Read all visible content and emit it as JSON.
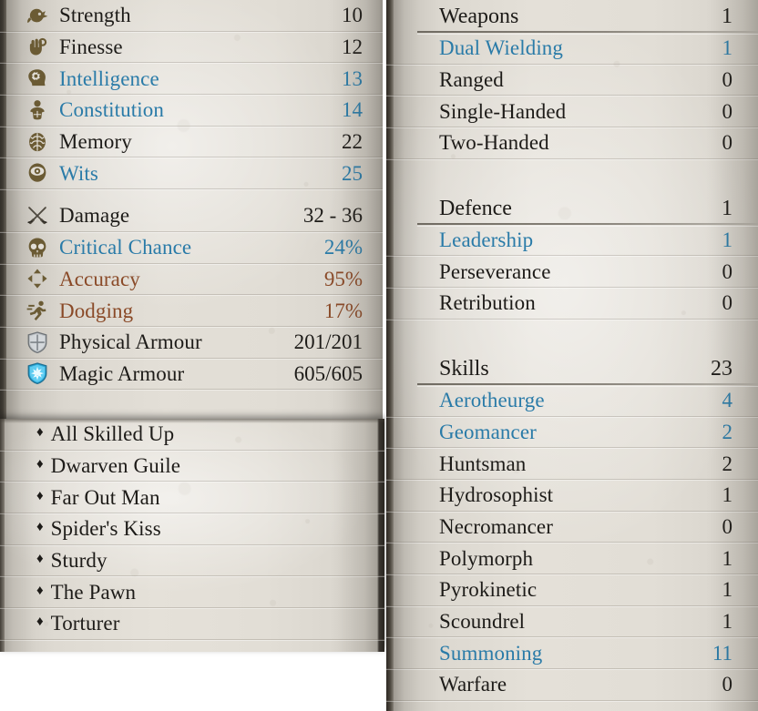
{
  "attributes": [
    {
      "icon": "strength-icon",
      "label": "Strength",
      "value": "10",
      "color": "dark"
    },
    {
      "icon": "finesse-icon",
      "label": "Finesse",
      "value": "12",
      "color": "dark"
    },
    {
      "icon": "intelligence-icon",
      "label": "Intelligence",
      "value": "13",
      "color": "blue"
    },
    {
      "icon": "constitution-icon",
      "label": "Constitution",
      "value": "14",
      "color": "blue"
    },
    {
      "icon": "memory-icon",
      "label": "Memory",
      "value": "22",
      "color": "dark"
    },
    {
      "icon": "wits-icon",
      "label": "Wits",
      "value": "25",
      "color": "blue"
    }
  ],
  "combat_stats": [
    {
      "icon": "damage-icon",
      "label": "Damage",
      "value": "32 - 36",
      "color": "dark"
    },
    {
      "icon": "critical-chance-icon",
      "label": "Critical Chance",
      "value": "24%",
      "color": "blue"
    },
    {
      "icon": "accuracy-icon",
      "label": "Accuracy",
      "value": "95%",
      "color": "rust"
    },
    {
      "icon": "dodging-icon",
      "label": "Dodging",
      "value": "17%",
      "color": "rust"
    },
    {
      "icon": "physical-armour-icon",
      "label": "Physical Armour",
      "value": "201/201",
      "color": "dark"
    },
    {
      "icon": "magic-armour-icon",
      "label": "Magic Armour",
      "value": "605/605",
      "color": "dark"
    }
  ],
  "talents": {
    "bullet": "♦",
    "items": [
      {
        "label": "All Skilled Up"
      },
      {
        "label": "Dwarven Guile"
      },
      {
        "label": "Far Out Man"
      },
      {
        "label": "Spider's Kiss"
      },
      {
        "label": "Sturdy"
      },
      {
        "label": "The Pawn"
      },
      {
        "label": "Torturer"
      }
    ]
  },
  "groups": [
    {
      "title": "Weapons",
      "total": "1",
      "items": [
        {
          "label": "Dual Wielding",
          "value": "1",
          "color": "blue"
        },
        {
          "label": "Ranged",
          "value": "0",
          "color": "dark"
        },
        {
          "label": "Single-Handed",
          "value": "0",
          "color": "dark"
        },
        {
          "label": "Two-Handed",
          "value": "0",
          "color": "dark"
        }
      ]
    },
    {
      "title": "Defence",
      "total": "1",
      "items": [
        {
          "label": "Leadership",
          "value": "1",
          "color": "blue"
        },
        {
          "label": "Perseverance",
          "value": "0",
          "color": "dark"
        },
        {
          "label": "Retribution",
          "value": "0",
          "color": "dark"
        }
      ]
    },
    {
      "title": "Skills",
      "total": "23",
      "items": [
        {
          "label": "Aerotheurge",
          "value": "4",
          "color": "blue"
        },
        {
          "label": "Geomancer",
          "value": "2",
          "color": "blue"
        },
        {
          "label": "Huntsman",
          "value": "2",
          "color": "dark"
        },
        {
          "label": "Hydrosophist",
          "value": "1",
          "color": "dark"
        },
        {
          "label": "Necromancer",
          "value": "0",
          "color": "dark"
        },
        {
          "label": "Polymorph",
          "value": "1",
          "color": "dark"
        },
        {
          "label": "Pyrokinetic",
          "value": "1",
          "color": "dark"
        },
        {
          "label": "Scoundrel",
          "value": "1",
          "color": "dark"
        },
        {
          "label": "Summoning",
          "value": "11",
          "color": "blue"
        },
        {
          "label": "Warfare",
          "value": "0",
          "color": "dark"
        }
      ]
    }
  ],
  "colors": {
    "text_dark": "#1d1b18",
    "text_blue": "#2a7ba8",
    "text_rust": "#8a4a28",
    "icon_brown": "#6b5b34",
    "parchment": "#e3dfd7"
  }
}
